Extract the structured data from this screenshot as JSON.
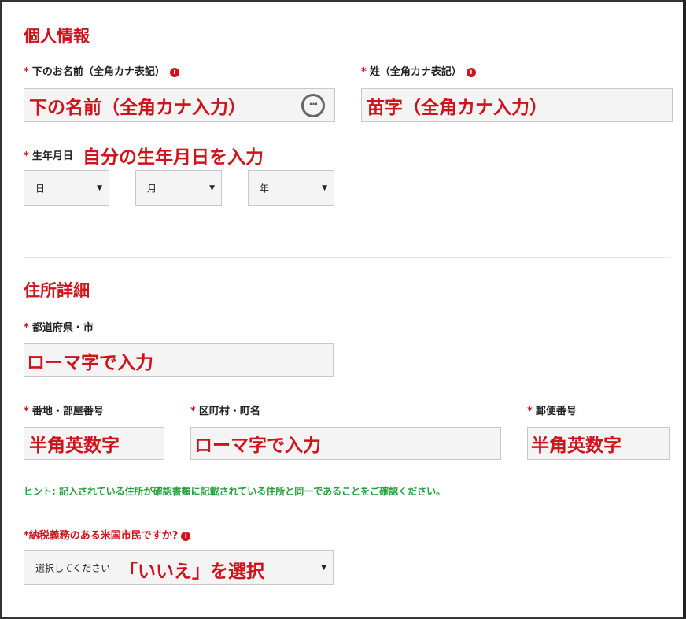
{
  "personal": {
    "title": "個人情報",
    "first_name_label": "下のお名前（全角カナ表記）",
    "first_name_value": "下の名前（全角カナ入力）",
    "last_name_label": "姓（全角カナ表記）",
    "last_name_value": "苗字（全角カナ入力）",
    "dob_label": "生年月日",
    "dob_annotation": "自分の生年月日を入力",
    "dob_day": "日",
    "dob_month": "月",
    "dob_year": "年",
    "required_mark": "*",
    "info_glyph": "i"
  },
  "address": {
    "title": "住所詳細",
    "prefecture_label": "都道府県・市",
    "prefecture_value": "ローマ字で入力",
    "street_label": "番地・部屋番号",
    "street_value": "半角英数字",
    "town_label": "区町村・町名",
    "town_value": "ローマ字で入力",
    "postal_label": "郵便番号",
    "postal_value": "半角英数字",
    "hint": "ヒント: 記入されている住所が確認書類に記載されている住所と同一であることをご確認ください。",
    "tax_label": "*納税義務のある米国市民ですか?",
    "tax_select_value": "選択してください",
    "tax_annotation": "「いいえ」を選択"
  },
  "colors": {
    "accent": "#d0121b",
    "hint": "#22a13c",
    "field_bg": "#f4f4f4"
  }
}
